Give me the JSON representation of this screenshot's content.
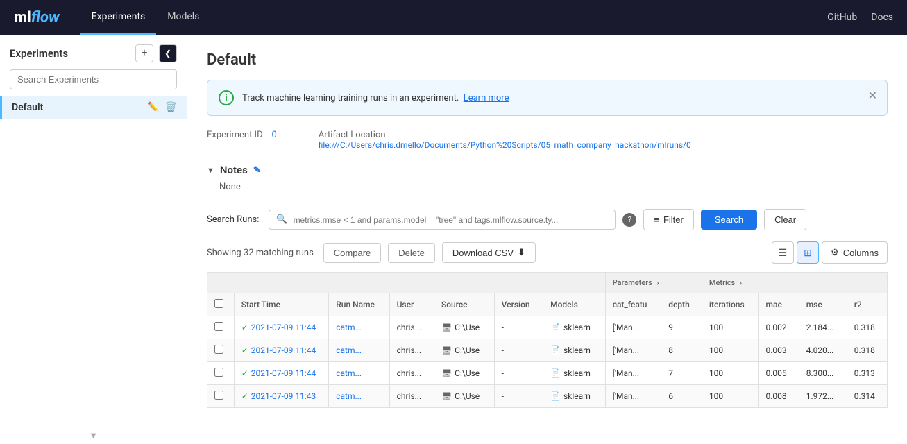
{
  "nav": {
    "logo_ml": "ml",
    "logo_flow": "flow",
    "links": [
      "Experiments",
      "Models"
    ],
    "active_link": "Experiments",
    "right_links": [
      "GitHub",
      "Docs"
    ]
  },
  "sidebar": {
    "title": "Experiments",
    "add_btn_label": "+",
    "collapse_btn_label": "❮",
    "search_placeholder": "Search Experiments",
    "experiments": [
      {
        "label": "Default"
      }
    ]
  },
  "main": {
    "page_title": "Default",
    "banner": {
      "text": "Track machine learning training runs in an experiment.",
      "link_text": "Learn more"
    },
    "experiment_id_label": "Experiment ID :",
    "experiment_id_value": "0",
    "artifact_location_label": "Artifact Location :",
    "artifact_location_value": "file:///C:/Users/chris.dmello/Documents/Python%20Scripts/05_math_company_hackathon/mlruns/0",
    "notes": {
      "label": "Notes",
      "value": "None"
    },
    "search_runs": {
      "label": "Search Runs:",
      "placeholder": "metrics.rmse < 1 and params.model = \"tree\" and tags.mlflow.source.ty...",
      "filter_label": "Filter",
      "search_label": "Search",
      "clear_label": "Clear"
    },
    "results": {
      "text": "Showing 32 matching runs",
      "compare_label": "Compare",
      "delete_label": "Delete",
      "download_label": "Download CSV"
    },
    "columns_btn_label": "Columns",
    "table": {
      "section_headers": [
        {
          "label": "Parameters",
          "span": 2
        },
        {
          "label": "Metrics",
          "span": 4
        }
      ],
      "headers": [
        "",
        "Start Time",
        "Run Name",
        "User",
        "Source",
        "Version",
        "Models",
        "cat_featu",
        "depth",
        "iterations",
        "mae",
        "mse",
        "r2"
      ],
      "rows": [
        {
          "start_time": "2021-07-09 11:44",
          "run_name": "catm...",
          "user": "chris...",
          "source": "C:\\Use",
          "version": "-",
          "model": "sklearn",
          "cat_features": "['Man...",
          "depth": "9",
          "iterations": "100",
          "mae": "0.002",
          "mse": "2.184...",
          "r2": "0.318"
        },
        {
          "start_time": "2021-07-09 11:44",
          "run_name": "catm...",
          "user": "chris...",
          "source": "C:\\Use",
          "version": "-",
          "model": "sklearn",
          "cat_features": "['Man...",
          "depth": "8",
          "iterations": "100",
          "mae": "0.003",
          "mse": "4.020...",
          "r2": "0.318"
        },
        {
          "start_time": "2021-07-09 11:44",
          "run_name": "catm...",
          "user": "chris...",
          "source": "C:\\Use",
          "version": "-",
          "model": "sklearn",
          "cat_features": "['Man...",
          "depth": "7",
          "iterations": "100",
          "mae": "0.005",
          "mse": "8.300...",
          "r2": "0.313"
        },
        {
          "start_time": "2021-07-09 11:43",
          "run_name": "catm...",
          "user": "chris...",
          "source": "C:\\Use",
          "version": "-",
          "model": "sklearn",
          "cat_features": "['Man...",
          "depth": "6",
          "iterations": "100",
          "mae": "0.008",
          "mse": "1.972...",
          "r2": "0.314"
        }
      ]
    }
  }
}
